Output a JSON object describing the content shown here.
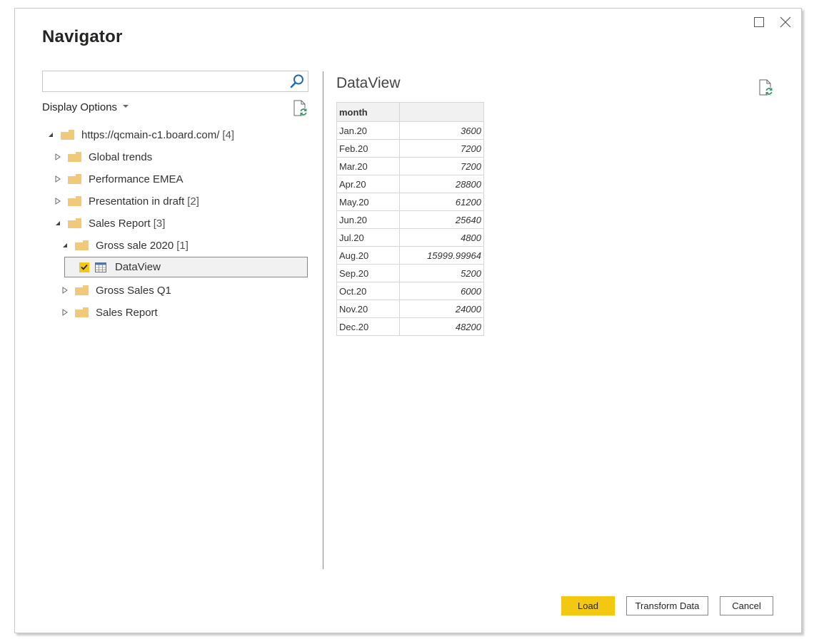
{
  "window": {
    "title": "Navigator",
    "maximize_icon": "maximize-icon",
    "close_icon": "close-icon"
  },
  "left_pane": {
    "search": {
      "value": "",
      "placeholder": "",
      "icon": "search-icon"
    },
    "display_options_label": "Display Options",
    "refresh_icon": "refresh-document-icon",
    "tree": [
      {
        "label": "https://qcmain-c1.board.com/",
        "count": "[4]",
        "level": 0,
        "expanded": true,
        "type": "folder"
      },
      {
        "label": "Global trends",
        "count": "",
        "level": 1,
        "expanded": false,
        "type": "folder"
      },
      {
        "label": "Performance EMEA",
        "count": "",
        "level": 1,
        "expanded": false,
        "type": "folder"
      },
      {
        "label": "Presentation in draft",
        "count": "[2]",
        "level": 1,
        "expanded": false,
        "type": "folder"
      },
      {
        "label": "Sales Report",
        "count": "[3]",
        "level": 1,
        "expanded": true,
        "type": "folder"
      },
      {
        "label": "Gross sale 2020",
        "count": "[1]",
        "level": 2,
        "expanded": true,
        "type": "folder"
      },
      {
        "label": "DataView",
        "count": "",
        "level": 3,
        "type": "table",
        "checked": true,
        "selected": true
      },
      {
        "label": "Gross Sales Q1",
        "count": "",
        "level": 2,
        "expanded": false,
        "type": "folder"
      },
      {
        "label": "Sales Report",
        "count": "",
        "level": 2,
        "expanded": false,
        "type": "folder"
      }
    ]
  },
  "preview": {
    "title": "DataView",
    "refresh_icon": "refresh-document-icon",
    "columns": [
      "month",
      ""
    ],
    "rows": [
      [
        "Jan.20",
        "3600"
      ],
      [
        "Feb.20",
        "7200"
      ],
      [
        "Mar.20",
        "7200"
      ],
      [
        "Apr.20",
        "28800"
      ],
      [
        "May.20",
        "61200"
      ],
      [
        "Jun.20",
        "25640"
      ],
      [
        "Jul.20",
        "4800"
      ],
      [
        "Aug.20",
        "15999.99964"
      ],
      [
        "Sep.20",
        "5200"
      ],
      [
        "Oct.20",
        "6000"
      ],
      [
        "Nov.20",
        "24000"
      ],
      [
        "Dec.20",
        "48200"
      ]
    ]
  },
  "footer": {
    "load_label": "Load",
    "transform_label": "Transform Data",
    "cancel_label": "Cancel"
  },
  "colors": {
    "accent": "#f2c811",
    "folder": "#f0c97a",
    "refresh_green": "#3a9a6a",
    "search_blue": "#1b6bb5"
  }
}
